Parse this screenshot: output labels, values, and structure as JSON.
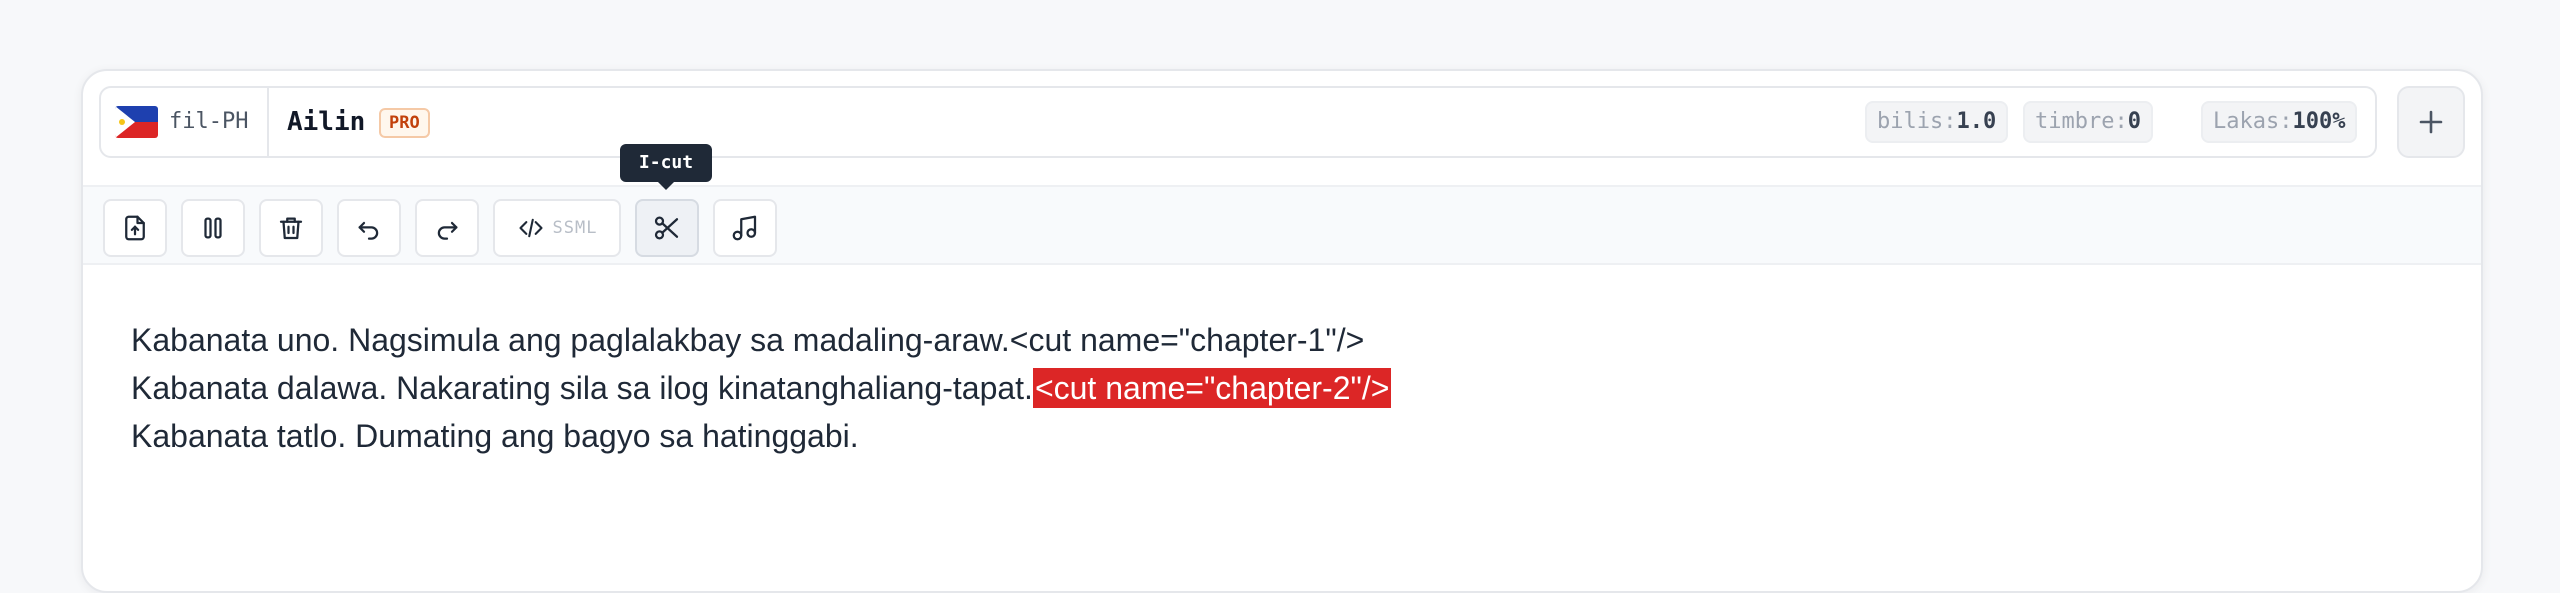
{
  "voice": {
    "flag_icon": "philippines-flag-icon",
    "lang_code": "fil-PH",
    "name": "Ailin",
    "badge": "PRO"
  },
  "params": [
    {
      "key": "bilis:",
      "value": "1.0"
    },
    {
      "key": "timbre:",
      "value": "0"
    },
    {
      "key": "Lakas:",
      "value": "100%"
    }
  ],
  "add_button": {
    "icon": "plus-icon"
  },
  "toolbar": {
    "buttons": [
      {
        "icon": "file-upload-icon"
      },
      {
        "icon": "pause-icon"
      },
      {
        "icon": "trash-icon"
      },
      {
        "icon": "undo-icon"
      },
      {
        "icon": "redo-icon"
      },
      {
        "icon": "code-icon",
        "label": "SSML"
      },
      {
        "icon": "scissors-icon",
        "active": true
      },
      {
        "icon": "music-note-icon"
      }
    ],
    "tooltip": "I-cut"
  },
  "editor": {
    "lines": [
      {
        "text": "Kabanata uno. Nagsimula ang paglalakbay sa madaling-araw.",
        "tag": "<cut name=\"chapter-1\"/>",
        "highlighted": false
      },
      {
        "text": "Kabanata dalawa. Nakarating sila sa ilog kinatanghaliang-tapat.",
        "tag": "<cut name=\"chapter-2\"/>",
        "highlighted": true
      },
      {
        "text": "Kabanata tatlo. Dumating ang bagyo sa hatinggabi.",
        "tag": "",
        "highlighted": false
      }
    ]
  },
  "colors": {
    "highlight": "#dc2626",
    "badge_text": "#c2410c",
    "tooltip_bg": "#1f2937"
  }
}
